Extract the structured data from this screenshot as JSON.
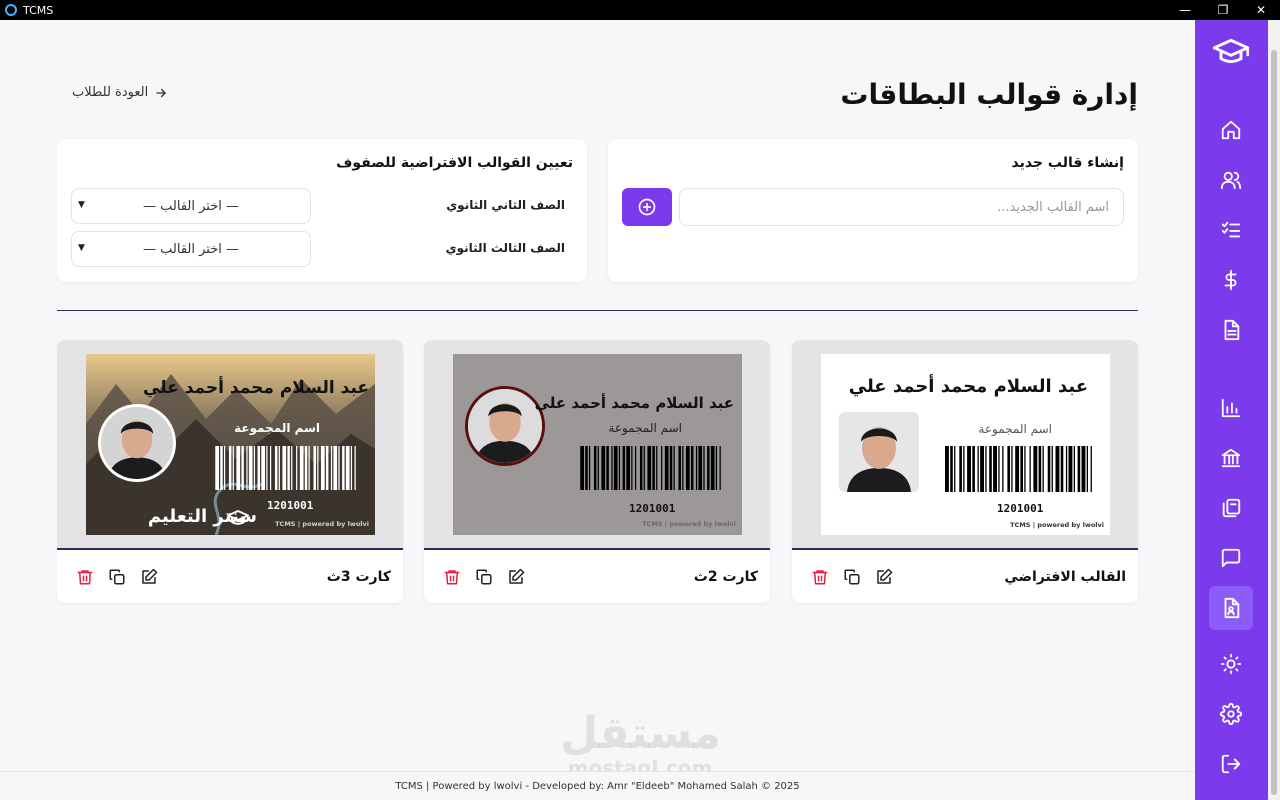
{
  "window": {
    "title": "TCMS"
  },
  "header": {
    "title": "إدارة قوالب البطاقات",
    "back_label": "العودة للطلاب"
  },
  "new_template": {
    "title": "إنشاء قالب جديد",
    "placeholder": "اسم القالب الجديد..."
  },
  "defaults": {
    "title": "تعيين القوالب الافتراضية للصفوف",
    "rows": [
      {
        "label": "الصف الثاني الثانوي",
        "selected": "— اختر القالب —"
      },
      {
        "label": "الصف الثالث الثانوي",
        "selected": "— اختر القالب —"
      }
    ]
  },
  "templates": [
    {
      "name": "القالب الافتراضي"
    },
    {
      "name": "كارت 2ث"
    },
    {
      "name": "كارت 3ث"
    }
  ],
  "card_sample": {
    "student_name": "عبد السلام محمد أحمد علي",
    "group_label": "اسم المجموعة",
    "code": "1201001",
    "powered": "TCMS | powered by lwolvi",
    "brand": "سنتر التعليم"
  },
  "footer": {
    "text": "TCMS | Powered by lwolvi - Developed by: Amr \"Eldeeb\" Mohamed Salah © 2025"
  },
  "watermark": {
    "line1": "مستقل",
    "line2": "mostaql.com"
  },
  "colors": {
    "accent": "#7c3aed",
    "danger": "#e11d48",
    "divider": "#2e2e5e"
  }
}
